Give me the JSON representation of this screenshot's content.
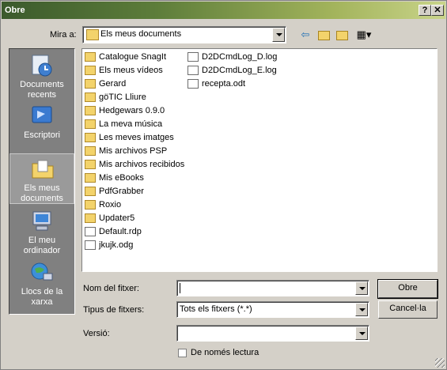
{
  "window": {
    "title": "Obre",
    "help_glyph": "?",
    "close_glyph": "✕"
  },
  "look_in": {
    "label": "Mira a:",
    "value": "Els meus documents"
  },
  "toolbar": {
    "back_icon": "back-arrow-icon",
    "up_icon": "up-folder-icon",
    "newfolder_icon": "new-folder-icon",
    "view_icon": "view-menu-icon"
  },
  "places": [
    {
      "label": "Documents recents",
      "icon": "recent-documents-icon"
    },
    {
      "label": "Escriptori",
      "icon": "desktop-icon"
    },
    {
      "label": "Els meus documents",
      "icon": "my-documents-icon",
      "selected": true
    },
    {
      "label": "El meu ordinador",
      "icon": "my-computer-icon"
    },
    {
      "label": "Llocs de la xarxa",
      "icon": "network-places-icon"
    }
  ],
  "files_col1": [
    {
      "name": "Catalogue SnagIt",
      "type": "folder"
    },
    {
      "name": "Els meus vídeos",
      "type": "folder-special"
    },
    {
      "name": "Gerard",
      "type": "folder"
    },
    {
      "name": "göTIC Lliure",
      "type": "folder"
    },
    {
      "name": "Hedgewars 0.9.0",
      "type": "folder"
    },
    {
      "name": "La meva música",
      "type": "folder-special"
    },
    {
      "name": "Les meves imatges",
      "type": "folder-special"
    },
    {
      "name": "Mis archivos PSP",
      "type": "folder"
    },
    {
      "name": "Mis archivos recibidos",
      "type": "folder"
    },
    {
      "name": "Mis eBooks",
      "type": "folder"
    },
    {
      "name": "PdfGrabber",
      "type": "folder"
    },
    {
      "name": "Roxio",
      "type": "folder"
    },
    {
      "name": "Updater5",
      "type": "folder"
    },
    {
      "name": "Default.rdp",
      "type": "file"
    },
    {
      "name": "jkujk.odg",
      "type": "file"
    }
  ],
  "files_col2": [
    {
      "name": "D2DCmdLog_D.log",
      "type": "file"
    },
    {
      "name": "D2DCmdLog_E.log",
      "type": "file"
    },
    {
      "name": "recepta.odt",
      "type": "file"
    }
  ],
  "filename": {
    "label": "Nom del fitxer:",
    "value": ""
  },
  "filetype": {
    "label": "Tipus de fitxers:",
    "value": "Tots els fitxers (*.*)"
  },
  "version": {
    "label": "Versió:",
    "value": ""
  },
  "buttons": {
    "open": "Obre",
    "cancel": "Cancel·la"
  },
  "readonly": {
    "label": "De només lectura",
    "checked": false
  }
}
